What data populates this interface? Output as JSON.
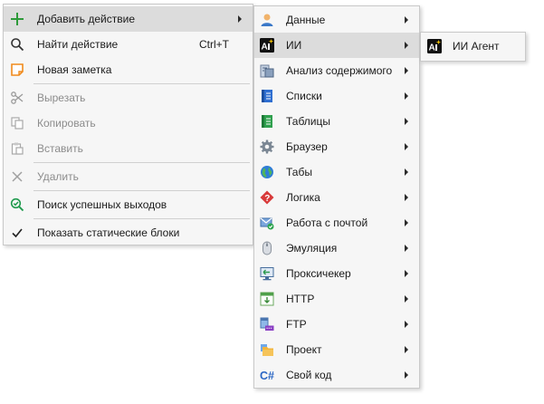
{
  "main_menu": {
    "add_action": "Добавить действие",
    "find_action": "Найти действие",
    "find_action_shortcut": "Ctrl+T",
    "new_note": "Новая заметка",
    "cut": "Вырезать",
    "copy": "Копировать",
    "paste": "Вставить",
    "delete": "Удалить",
    "search_success": "Поиск успешных выходов",
    "show_static": "Показать статические блоки"
  },
  "submenu": {
    "items": [
      {
        "label": "Данные",
        "icon": "user-data-icon"
      },
      {
        "label": "ИИ",
        "icon": "ai-icon"
      },
      {
        "label": "Анализ содержимого",
        "icon": "content-analysis-icon"
      },
      {
        "label": "Списки",
        "icon": "lists-icon"
      },
      {
        "label": "Таблицы",
        "icon": "tables-icon"
      },
      {
        "label": "Браузер",
        "icon": "browser-gear-icon"
      },
      {
        "label": "Табы",
        "icon": "globe-icon"
      },
      {
        "label": "Логика",
        "icon": "logic-icon"
      },
      {
        "label": "Работа с почтой",
        "icon": "mail-icon"
      },
      {
        "label": "Эмуляция",
        "icon": "mouse-icon"
      },
      {
        "label": "Проксичекер",
        "icon": "proxy-checker-icon"
      },
      {
        "label": "HTTP",
        "icon": "http-icon"
      },
      {
        "label": "FTP",
        "icon": "ftp-icon"
      },
      {
        "label": "Проект",
        "icon": "folder-icon"
      },
      {
        "label": "Свой код",
        "icon": "csharp-icon"
      }
    ]
  },
  "ai_menu": {
    "agent": "ИИ Агент"
  },
  "colors": {
    "highlight": "#dcdcdc",
    "menu_bg": "#f6f6f6",
    "disabled_text": "#8c8c8c"
  }
}
